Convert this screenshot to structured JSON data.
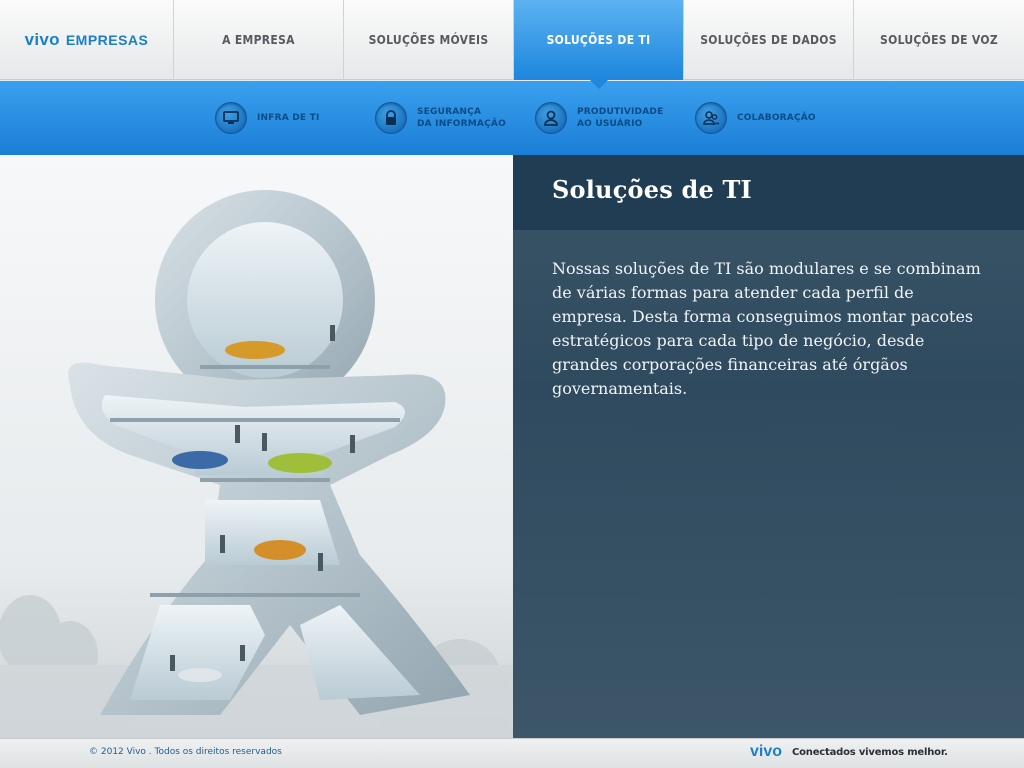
{
  "brand": {
    "name": "vivo",
    "suffix": "EMPRESAS",
    "color": "#1a7fc8"
  },
  "topnav": {
    "tabs": [
      {
        "label": "A EMPRESA",
        "active": false
      },
      {
        "label": "SOLUÇÕES MÓVEIS",
        "active": false
      },
      {
        "label": "SOLUÇÕES DE TI",
        "active": true
      },
      {
        "label": "SOLUÇÕES DE DADOS",
        "active": false
      },
      {
        "label": "SOLUÇÕES DE VOZ",
        "active": false
      }
    ]
  },
  "subnav": {
    "items": [
      {
        "label": "INFRA DE TI",
        "icon": "monitor-icon"
      },
      {
        "label": "SEGURANÇA\nDA INFORMAÇÃO",
        "icon": "lock-icon"
      },
      {
        "label": "PRODUTIVIDADE\nAO USUÁRIO",
        "icon": "user-icon"
      },
      {
        "label": "COLABORAÇÃO",
        "icon": "people-icon"
      }
    ]
  },
  "main": {
    "title": "Soluções de TI",
    "description": "Nossas soluções de TI são modulares e se combinam de várias formas para atender cada perfil de empresa. Desta forma conseguimos montar pacotes estratégicos para cada tipo de negócio, desde grandes corporações financeiras até órgãos governamentais."
  },
  "footer": {
    "copyright": "© 2012 Vivo . Todos os direitos reservados",
    "brand": "vivo",
    "tagline": "Conectados vivemos melhor."
  }
}
